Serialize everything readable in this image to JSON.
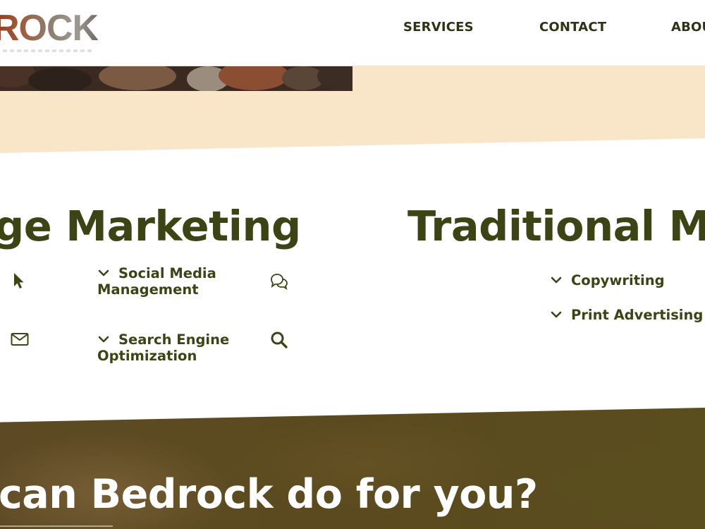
{
  "header": {
    "logo_text": "ROCK",
    "nav": {
      "services": "SERVICES",
      "contact": "CONTACT",
      "about": "ABOU"
    }
  },
  "sections": {
    "digital": {
      "heading": "ge Marketing",
      "items": [
        {
          "label": "Social Media Management",
          "icon": "chat-icon"
        },
        {
          "label": "Search Engine Optimization",
          "icon": "search-icon"
        }
      ],
      "left_icons": [
        "cursor-icon",
        "mail-icon"
      ]
    },
    "traditional": {
      "heading": "Traditional Ma",
      "items": [
        {
          "label": "Copywriting"
        },
        {
          "label": "Print Advertising"
        }
      ]
    }
  },
  "cta": {
    "text": "can Bedrock do for you?"
  },
  "colors": {
    "heading": "#3c4416",
    "nav": "#2e3316",
    "peach_band": "#f9e6c9",
    "dark_band": "#5b4a1f",
    "cta_text": "#ffffff"
  }
}
